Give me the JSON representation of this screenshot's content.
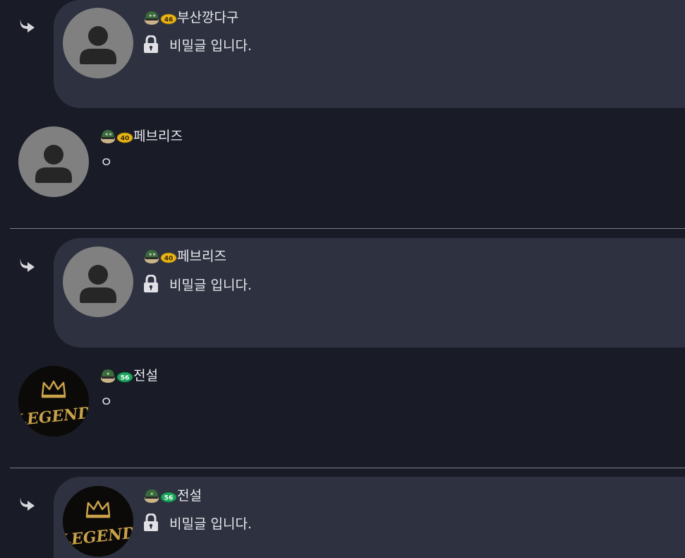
{
  "colors": {
    "background": "#191c27",
    "reply_box": "#2e3240",
    "text": "#e9e9ee",
    "divider": "#7c7f8a",
    "default_avatar_bg": "#808080",
    "default_avatar_fg": "#262626",
    "level_badge_gold": "#e8b419",
    "level_badge_green": "#1fa65f"
  },
  "comments": [
    {
      "type": "reply",
      "author": "부산깡다구",
      "level": "46",
      "avatar": "default-avatar",
      "secret_text": "비밀글 입니다."
    },
    {
      "type": "comment",
      "author": "페브리즈",
      "level": "40",
      "avatar": "default-avatar",
      "body": "ㅇ"
    },
    {
      "type": "reply",
      "author": "페브리즈",
      "level": "40",
      "avatar": "default-avatar",
      "secret_text": "비밀글 입니다."
    },
    {
      "type": "comment",
      "author": "전설",
      "level": "56",
      "avatar": "legend-avatar",
      "avatar_text": "LEGEND",
      "body": "ㅇ"
    },
    {
      "type": "reply",
      "author": "전설",
      "level": "56",
      "avatar": "legend-avatar",
      "avatar_text": "LEGEND",
      "secret_text": "비밀글 입니다."
    }
  ]
}
